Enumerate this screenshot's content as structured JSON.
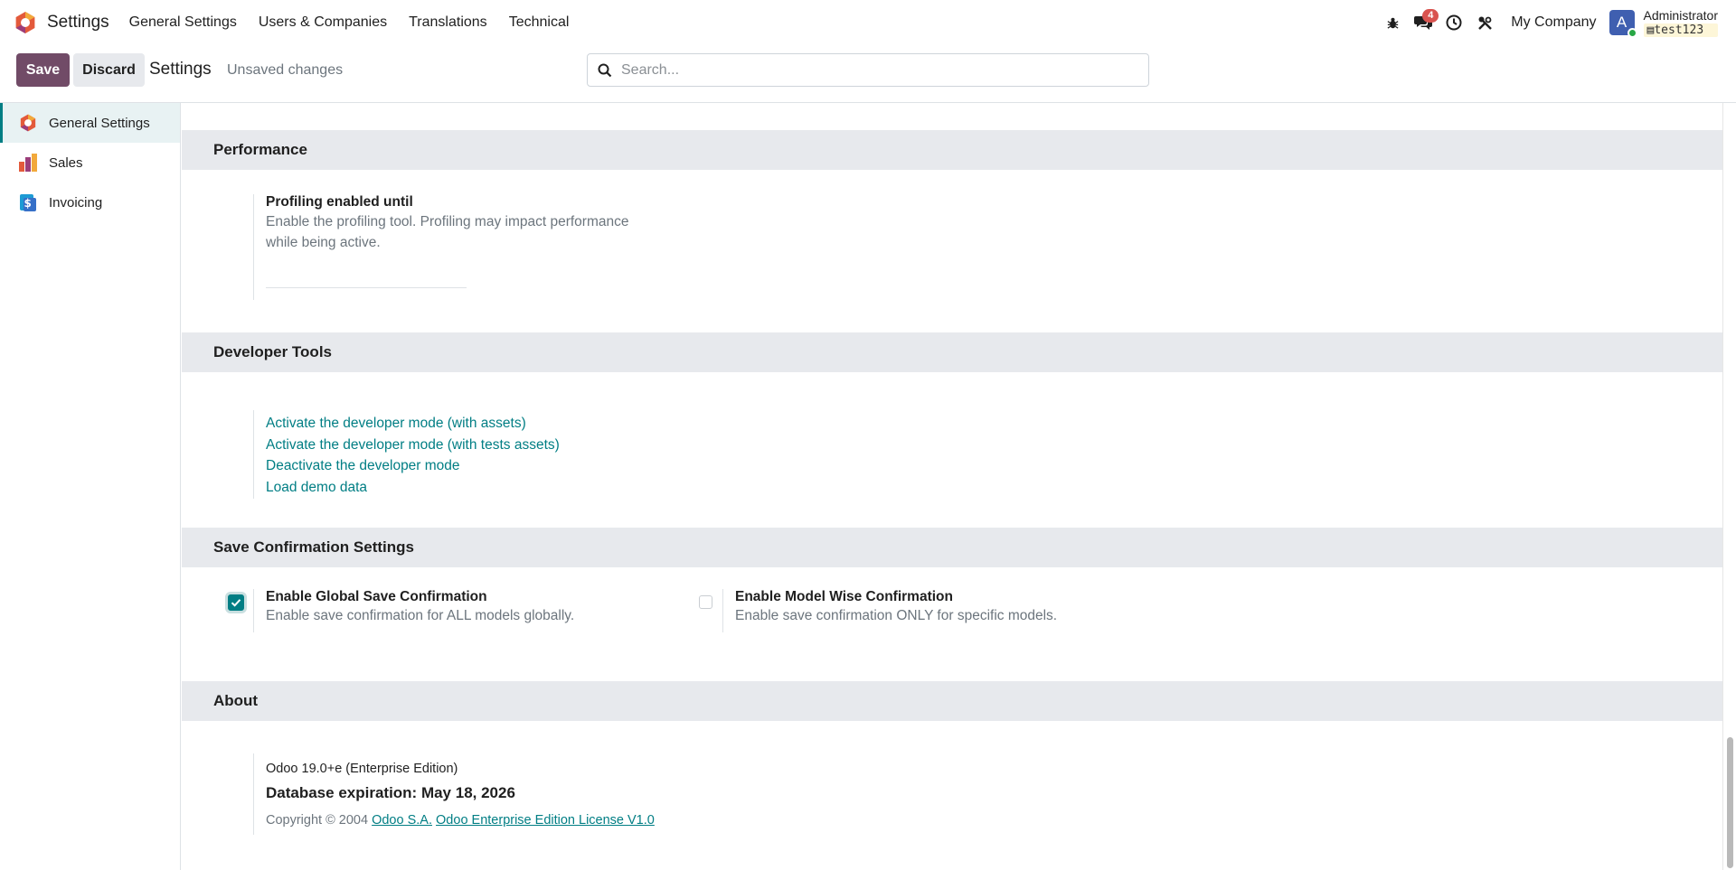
{
  "navbar": {
    "app_name": "Settings",
    "menus": [
      "General Settings",
      "Users & Companies",
      "Translations",
      "Technical"
    ],
    "messages_badge": "4",
    "company": "My Company",
    "avatar_letter": "A",
    "user_name": "Administrator",
    "database": "test123"
  },
  "control": {
    "save_label": "Save",
    "discard_label": "Discard",
    "title": "Settings",
    "status": "Unsaved changes",
    "search_placeholder": "Search..."
  },
  "sidebar": {
    "items": [
      {
        "label": "General Settings",
        "icon": "odoo-logo-icon",
        "active": true
      },
      {
        "label": "Sales",
        "icon": "sales-app-icon",
        "active": false
      },
      {
        "label": "Invoicing",
        "icon": "invoicing-app-icon",
        "active": false
      }
    ]
  },
  "performance": {
    "heading": "Performance",
    "title": "Profiling enabled until",
    "desc_line1": "Enable the profiling tool. Profiling may impact performance",
    "desc_line2": "while being active."
  },
  "developer_tools": {
    "heading": "Developer Tools",
    "links": [
      "Activate the developer mode (with assets)",
      "Activate the developer mode (with tests assets)",
      "Deactivate the developer mode",
      "Load demo data"
    ]
  },
  "save_confirmation": {
    "heading": "Save Confirmation Settings",
    "global": {
      "title": "Enable Global Save Confirmation",
      "desc": "Enable save confirmation for ALL models globally.",
      "checked": true
    },
    "model_wise": {
      "title": "Enable Model Wise Confirmation",
      "desc": "Enable save confirmation ONLY for specific models.",
      "checked": false
    }
  },
  "about": {
    "heading": "About",
    "version": "Odoo 19.0+e (Enterprise Edition)",
    "expiration": "Database expiration: May 18, 2026",
    "copyright": "Copyright © 2004",
    "company_link": "Odoo S.A.",
    "license_link": "Odoo Enterprise Edition License V1.0"
  },
  "colors": {
    "brand": "#714b67",
    "accent": "#017e84",
    "section_bg": "#e7e9ed"
  }
}
